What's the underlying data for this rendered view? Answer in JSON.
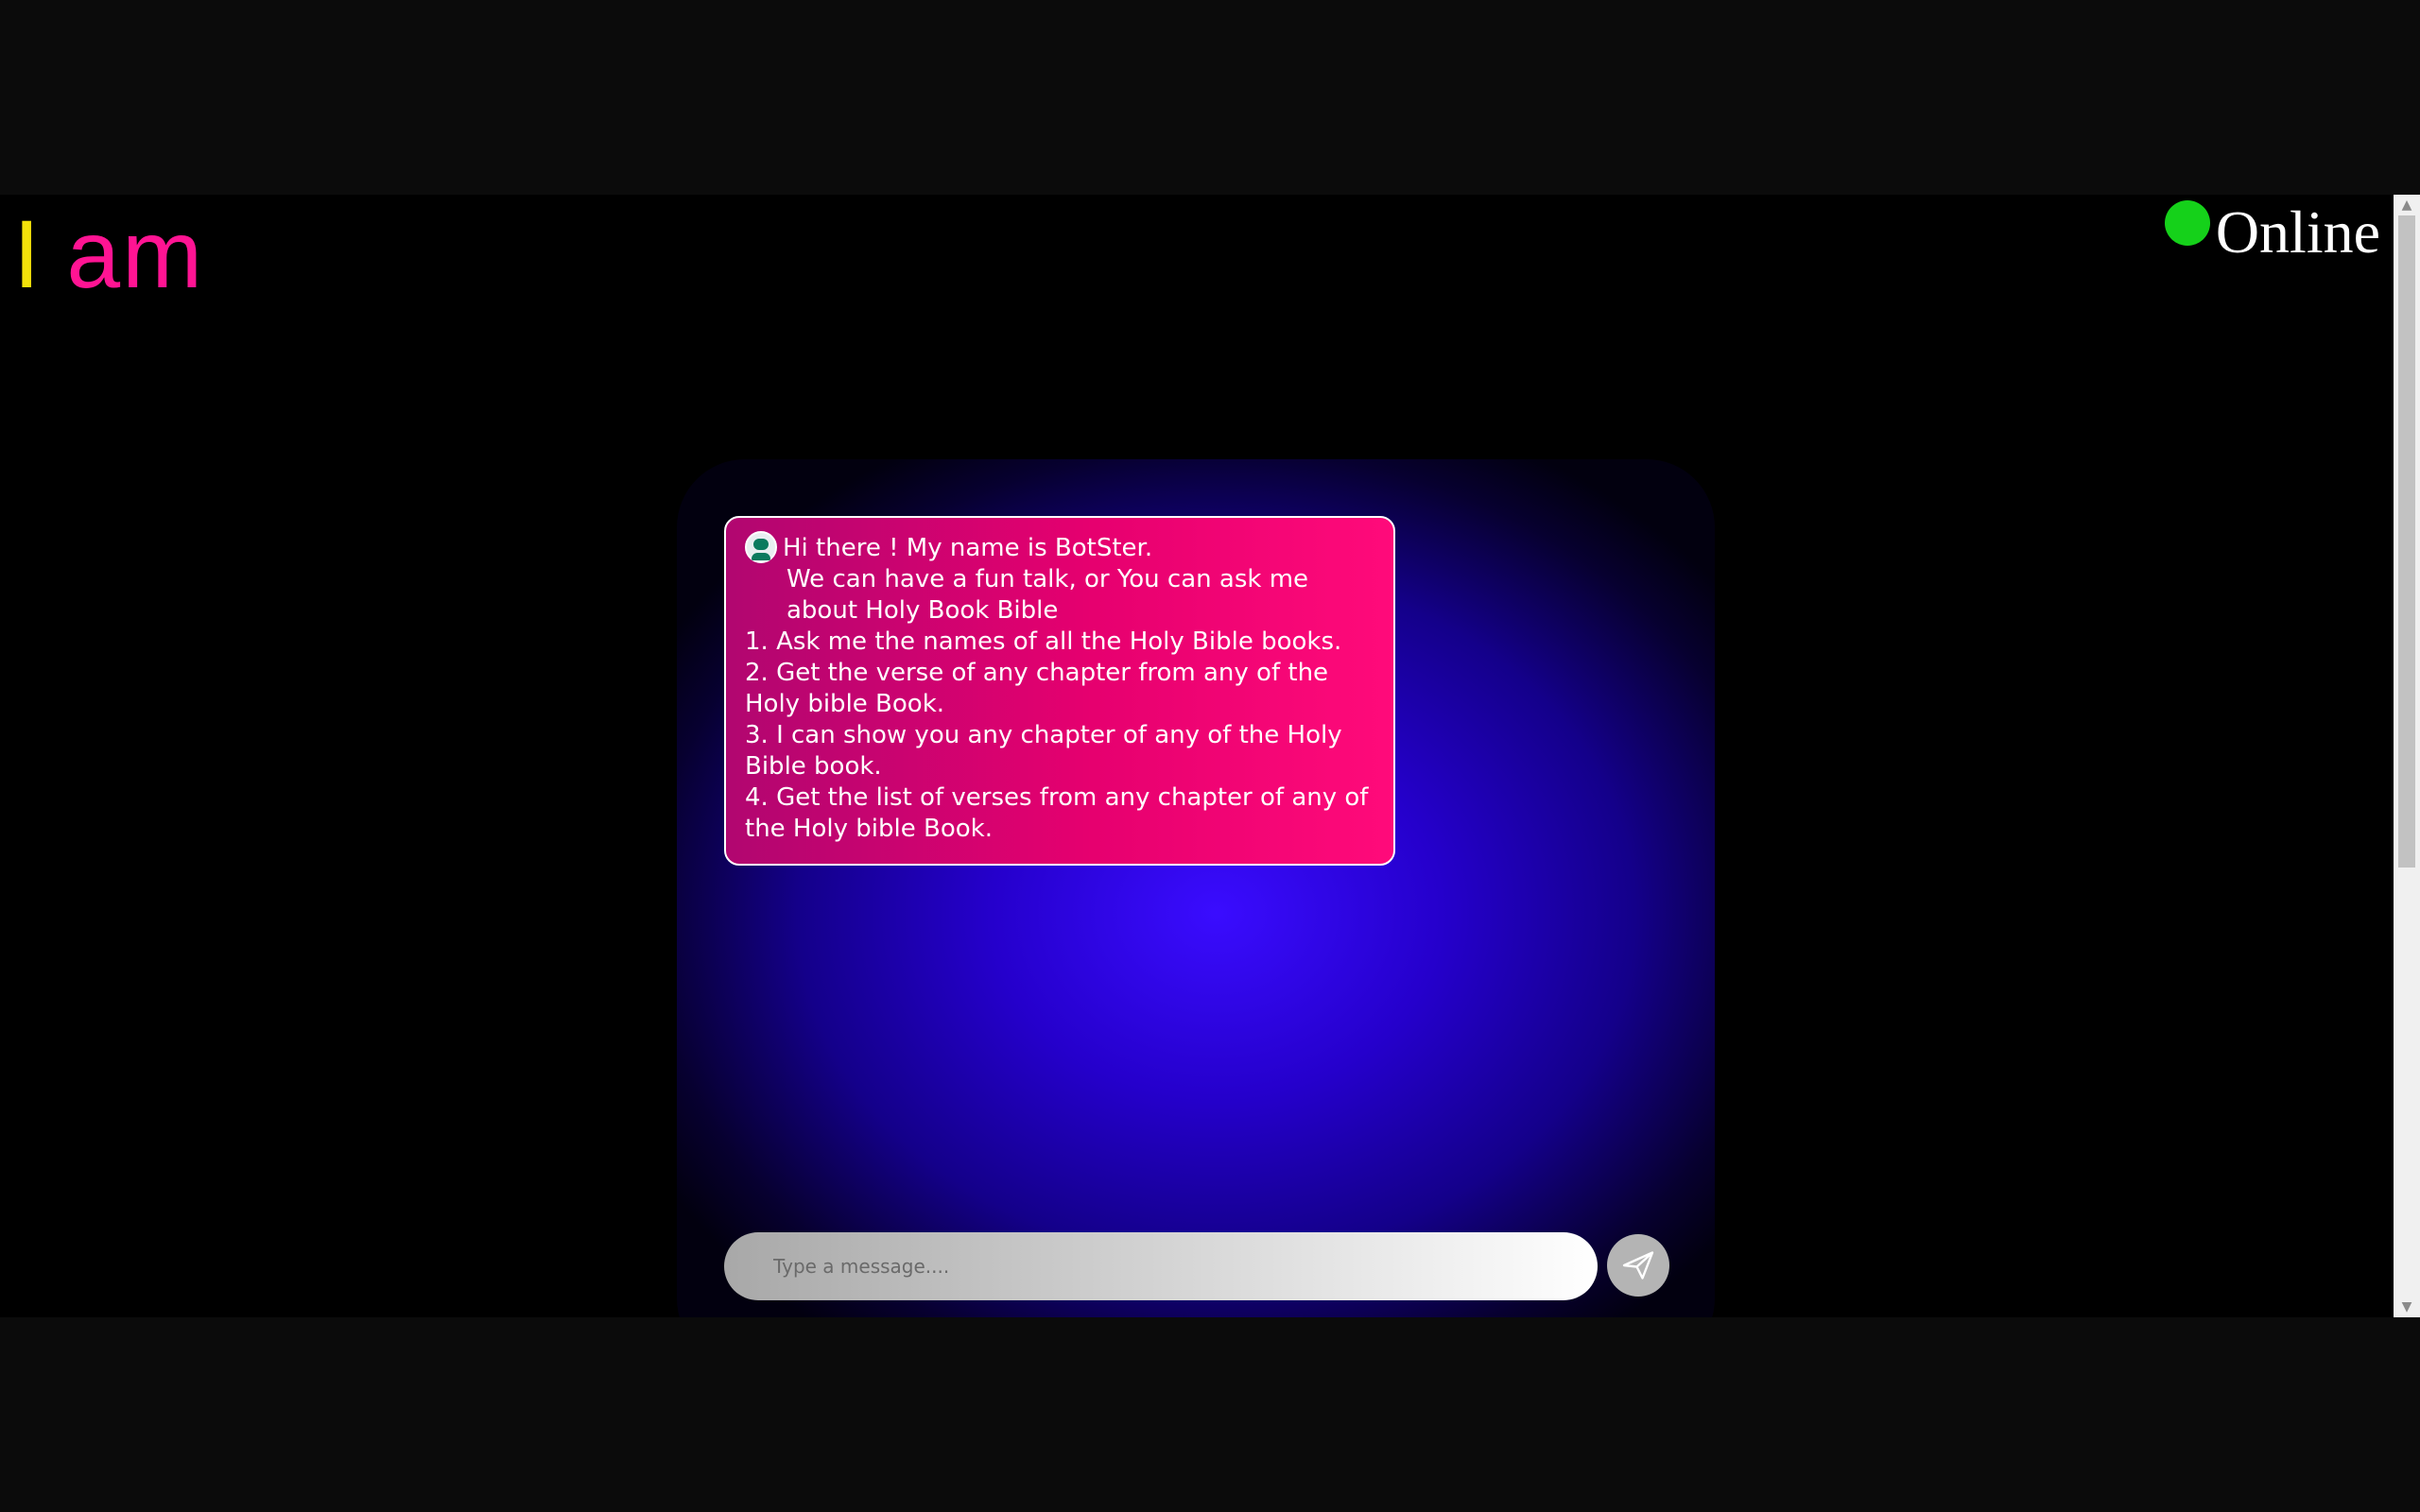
{
  "header": {
    "headline_first": "I",
    "headline_second": "am"
  },
  "status": {
    "label": "Online",
    "color": "#15d11a"
  },
  "chat": {
    "bot_icon": "robot-avatar-icon",
    "message_lines": [
      "Hi there ! My name is BotSter.",
      "We can have a fun talk, or You can ask me about Holy Book Bible",
      "1. Ask me the names of all the Holy Bible books.",
      "2. Get the verse of any chapter from any of the Holy bible Book.",
      "3. I can show you any chapter of any of the Holy Bible book.",
      "4. Get the list of verses from any chapter of any of the Holy bible Book."
    ]
  },
  "composer": {
    "placeholder": "Type a message....",
    "value": "",
    "send_icon": "paper-plane-icon"
  },
  "colors": {
    "bubble_pink": "#e6006f",
    "headline_yellow": "#f4e20a",
    "headline_pink": "#ff1493",
    "chat_blue": "#3a0cff"
  }
}
